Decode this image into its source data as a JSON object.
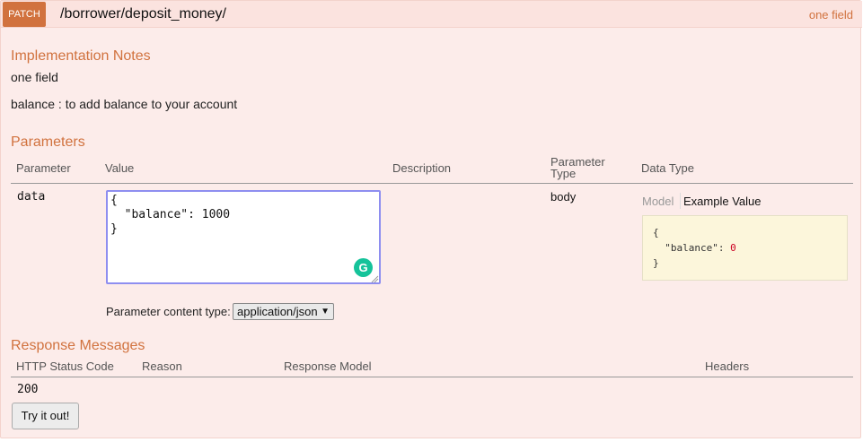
{
  "operation": {
    "method": "PATCH",
    "path": "/borrower/deposit_money/",
    "summary": "one field"
  },
  "implementation": {
    "heading": "Implementation Notes",
    "line1": "one field",
    "line2": "balance : to add balance to your account"
  },
  "parameters": {
    "heading": "Parameters",
    "columns": {
      "parameter": "Parameter",
      "value": "Value",
      "description": "Description",
      "param_type_line1": "Parameter",
      "param_type_line2": "Type",
      "data_type": "Data Type"
    },
    "rows": [
      {
        "name": "data",
        "value": "{\n  \"balance\": 1000\n}",
        "description": "",
        "param_type": "body",
        "model_tab": "Model",
        "example_tab": "Example Value",
        "example_open": "{",
        "example_key": "  \"balance\": ",
        "example_num": "0",
        "example_close": "}"
      }
    ],
    "content_type_label": "Parameter content type:",
    "content_type_value": "application/json",
    "grammarly_glyph": "G"
  },
  "responses": {
    "heading": "Response Messages",
    "columns": {
      "status": "HTTP Status Code",
      "reason": "Reason",
      "model": "Response Model",
      "headers": "Headers"
    },
    "rows": [
      {
        "status": "200"
      }
    ]
  },
  "try_button_label": "Try it out!"
}
